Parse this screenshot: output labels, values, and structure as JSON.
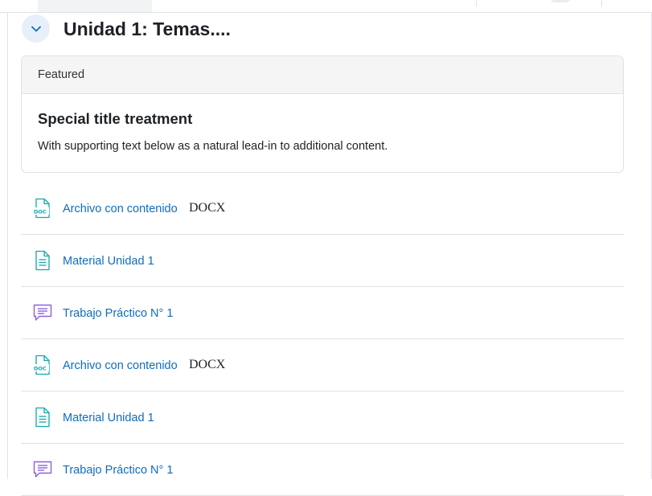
{
  "section": {
    "title": "Unidad 1: Temas....",
    "toggle_icon": "chevron-down-icon"
  },
  "card": {
    "header": "Featured",
    "title": "Special title treatment",
    "text": "With supporting text below as a natural lead-in to additional content."
  },
  "activities": [
    {
      "label": "Archivo con contenido",
      "badge": "DOCX",
      "icon": "docx-file-icon"
    },
    {
      "label": "Material Unidad 1",
      "badge": "",
      "icon": "page-icon"
    },
    {
      "label": "Trabajo Práctico N° 1",
      "badge": "",
      "icon": "forum-icon"
    },
    {
      "label": "Archivo con contenido",
      "badge": "DOCX",
      "icon": "docx-file-icon"
    },
    {
      "label": "Material Unidad 1",
      "badge": "",
      "icon": "page-icon"
    },
    {
      "label": "Trabajo Práctico N° 1",
      "badge": "",
      "icon": "forum-icon"
    }
  ],
  "colors": {
    "link": "#0f6cbf",
    "doc_icon": "#11a8ab",
    "forum_icon": "#8f5fe0",
    "toggle_bg": "#e7f0fa"
  }
}
